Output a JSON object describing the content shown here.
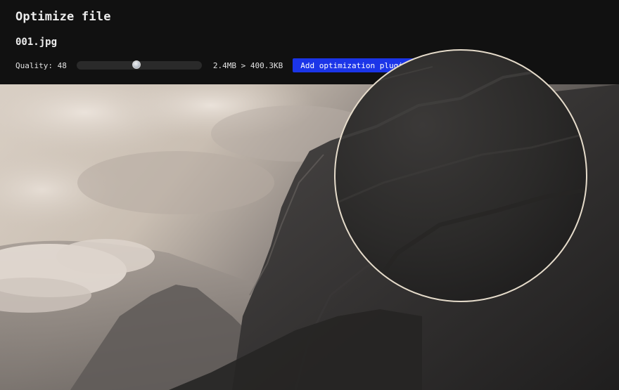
{
  "header": {
    "title": "Optimize file",
    "filename": "001.jpg"
  },
  "controls": {
    "quality_label": "Quality: 48",
    "quality_value": 48,
    "quality_max": 100,
    "size_info": "2.4MB > 400.3KB",
    "plugin_button_label": "Add optimization plugin"
  },
  "colors": {
    "background": "#111111",
    "accent": "#1b35e8",
    "text": "#ececec",
    "magnifier_ring": "#e6dccb"
  }
}
